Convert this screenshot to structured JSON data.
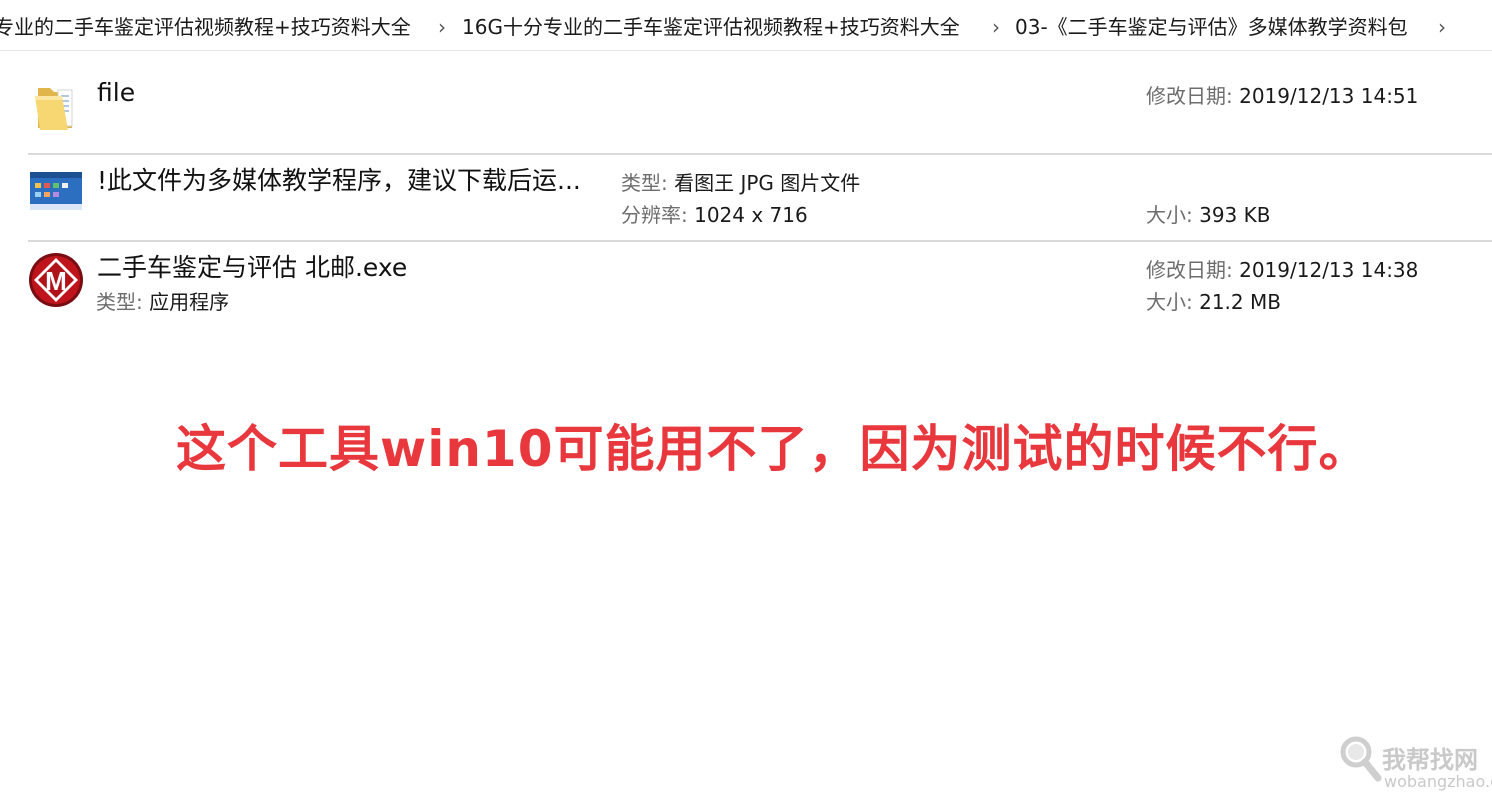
{
  "breadcrumb": {
    "items": [
      "专业的二手车鉴定评估视频教程+技巧资料大全",
      "16G十分专业的二手车鉴定评估视频教程+技巧资料大全",
      "03-《二手车鉴定与评估》多媒体教学资料包"
    ],
    "separator": "›"
  },
  "files": [
    {
      "name": "file",
      "icon": "folder-icon",
      "modified_label": "修改日期:",
      "modified_value": "2019/12/13 14:51"
    },
    {
      "name": "!此文件为多媒体教学程序，建议下载后运...",
      "icon": "image-thumbnail-icon",
      "type_label": "类型:",
      "type_value": "看图王 JPG 图片文件",
      "resolution_label": "分辨率:",
      "resolution_value": "1024 x 716",
      "size_label": "大小:",
      "size_value": "393 KB"
    },
    {
      "name": "二手车鉴定与评估 北邮.exe",
      "icon": "app-m-icon",
      "type_label": "类型:",
      "type_value": "应用程序",
      "modified_label": "修改日期:",
      "modified_value": "2019/12/13 14:38",
      "size_label": "大小:",
      "size_value": "21.2 MB"
    }
  ],
  "notice": "这个工具win10可能用不了，因为测试的时候不行。",
  "watermark": {
    "text": "我帮找网",
    "url": "wobangzhao.com",
    "icon": "magnifier-icon"
  },
  "colors": {
    "notice": "#e8383d",
    "label": "#6d6d6d",
    "separator": "#dadada"
  }
}
